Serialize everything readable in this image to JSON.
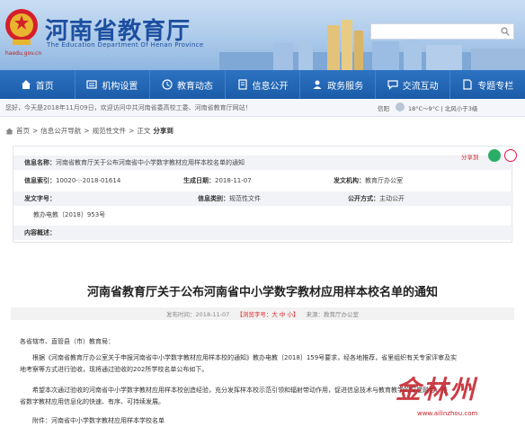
{
  "header": {
    "title": "河南省教育厅",
    "subtitle": "The Education Department Of Henan Province",
    "site_url": "haedu.gov.cn"
  },
  "nav": {
    "items": [
      {
        "label": "首页",
        "icon": "home-icon"
      },
      {
        "label": "机构设置",
        "icon": "org-icon"
      },
      {
        "label": "教育动态",
        "icon": "news-icon"
      },
      {
        "label": "信息公开",
        "icon": "info-icon"
      },
      {
        "label": "政务服务",
        "icon": "service-icon"
      },
      {
        "label": "交流互动",
        "icon": "chat-icon"
      },
      {
        "label": "专题专栏",
        "icon": "topic-icon"
      }
    ]
  },
  "infobar": {
    "welcome": "您好，今天是2018年11月09日，欢迎访问中共河南省委高校工委、河南省教育厅网站！",
    "weather_label": "信阳",
    "weather_text": "18°C～9°C  | 北风小于3级"
  },
  "breadcrumb": {
    "items": [
      "首页",
      "信息公开导航",
      "规范性文件",
      "正文"
    ],
    "current": "分享到"
  },
  "meta": {
    "share_label": "分享到",
    "info_name_label": "信息名称：",
    "info_name": "河南省教育厅关于公布河南省中小学数字教材应用样本校名单的通知",
    "index_label": "信息索引：",
    "index": "10020-:-2018-01614",
    "date_label": "生成日期：",
    "date": "2018-11-07",
    "org_label": "发文机构：",
    "org": "教育厅办公室",
    "docno_label": "发文字号：",
    "docno": "教办电教〔2018〕953号",
    "category_label": "信息类别：",
    "category": "规范性文件",
    "scope_label": "公开方式：",
    "scope": "主动公开",
    "summary_label": "内容概述："
  },
  "article": {
    "title": "河南省教育厅关于公布河南省中小学数字教材应用样本校名单的通知",
    "pub_prefix": "发布时间：",
    "pub_date": "2018-11-07",
    "font_label": "【浏览字号：",
    "font_sizes": "大  中  小",
    "font_suffix": "】",
    "source": "来源：教育厅办公室",
    "p1": "各省辖市、直管县（市）教育局：",
    "p2": "根据《河南省教育厅办公室关于申报河南省中小学数字教材应用样本校的通知》教办电教〔2018〕159号要求，经各地推荐，省里组织有关专家评审及实",
    "p2b": "地考察等方式进行验收，现将通过验收的202所学校名单公布如下。",
    "p3": "希望本次通过验收的河南省中小学数字教材应用样本校创造经验，充分发挥样本校示范引领和辐射带动作用，促进信息技术与教育教学的深度融合，推",
    "p3b": "省数字教材应用信息化的快速、有序、可持续发展。",
    "p4": "附件：河南省中小学数字教材应用样本学校名单"
  },
  "watermark": {
    "text": "金林州",
    "url": "www.ailinzhou.com"
  }
}
